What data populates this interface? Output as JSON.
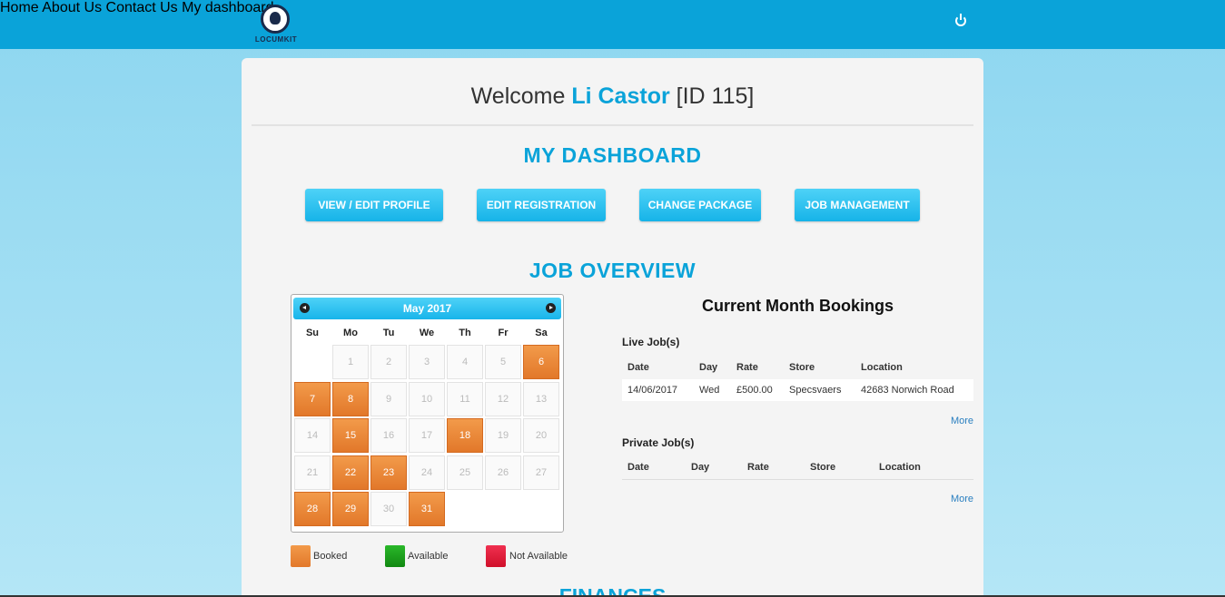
{
  "brand": {
    "logo_text": "LOCUMKIT"
  },
  "nav": {
    "home": "Home",
    "about": "About Us",
    "contact": "Contact Us",
    "dashboard": "My dashboard"
  },
  "welcome": {
    "prefix": "Welcome",
    "name": "Li Castor",
    "id": "[ID 115]"
  },
  "dashboard": {
    "title": "MY DASHBOARD",
    "buttons": [
      "VIEW / EDIT PROFILE",
      "EDIT REGISTRATION",
      "CHANGE PACKAGE",
      "JOB MANAGEMENT"
    ]
  },
  "overview": {
    "title": "JOB OVERVIEW"
  },
  "calendar": {
    "title": "May 2017",
    "weekdays": [
      "Su",
      "Mo",
      "Tu",
      "We",
      "Th",
      "Fr",
      "Sa"
    ],
    "first_weekday_index": 1,
    "days_in_month": 31,
    "booked_days": [
      6,
      7,
      8,
      15,
      18,
      22,
      23,
      28,
      29,
      31
    ],
    "colors": {
      "booked": "#e8843a",
      "available": "#1a9a1a",
      "not_available": "#e0173a"
    }
  },
  "legend": {
    "booked": "Booked",
    "available": "Available",
    "not_available": "Not Available"
  },
  "bookings": {
    "title": "Current Month Bookings",
    "live": {
      "heading": "Live Job(s)",
      "columns": [
        "Date",
        "Day",
        "Rate",
        "Store",
        "Location"
      ],
      "rows": [
        [
          "14/06/2017",
          "Wed",
          "£500.00",
          "Specsvaers",
          "42683 Norwich Road"
        ]
      ],
      "more": "More"
    },
    "private": {
      "heading": "Private Job(s)",
      "columns": [
        "Date",
        "Day",
        "Rate",
        "Store",
        "Location"
      ],
      "more": "More"
    }
  },
  "finances": {
    "title": "FINANCES"
  }
}
